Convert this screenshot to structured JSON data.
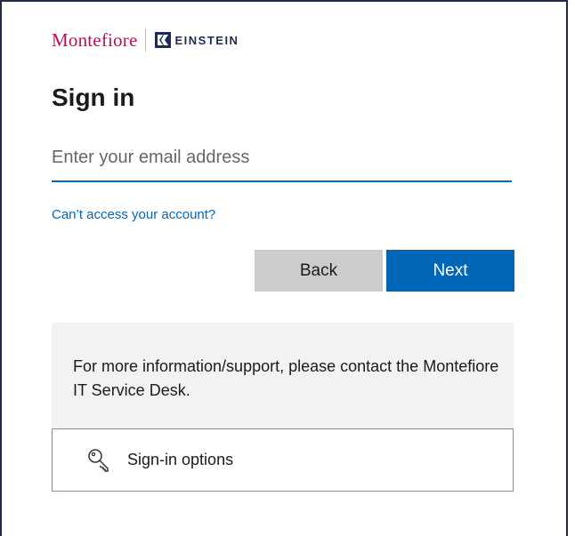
{
  "brand": {
    "primary_name": "Montefiore",
    "secondary_name": "EINSTEIN",
    "primary_color": "#b3125a",
    "secondary_color": "#1e2b57"
  },
  "form": {
    "title": "Sign in",
    "email_placeholder": "Enter your email address",
    "email_value": "",
    "access_link": "Can’t access your account?",
    "back_label": "Back",
    "next_label": "Next",
    "accent_color": "#0067b8"
  },
  "info": {
    "message": "For more information/support, please contact the Montefiore IT Service Desk."
  },
  "options": {
    "icon": "key-icon",
    "label": "Sign-in options"
  }
}
